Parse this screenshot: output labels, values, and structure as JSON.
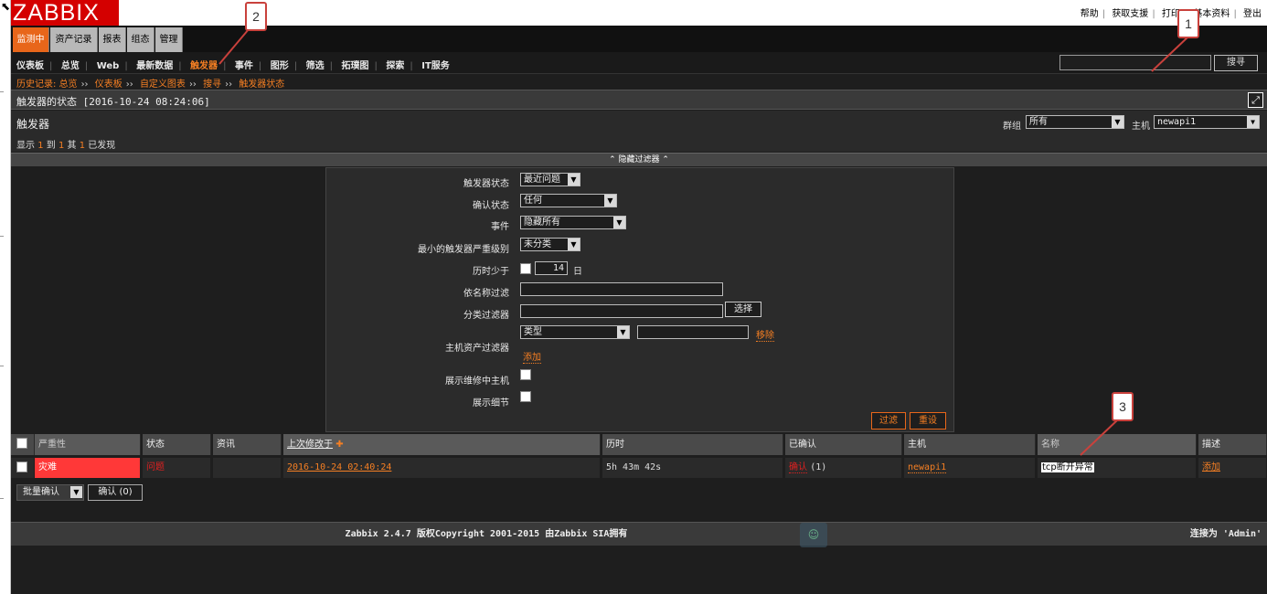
{
  "header": {
    "logo": "ZABBIX",
    "links": [
      "帮助",
      "获取支援",
      "打印",
      "基本资料",
      "登出"
    ]
  },
  "main_tabs": [
    {
      "label": "监测中",
      "active": true
    },
    {
      "label": "资产记录",
      "active": false
    },
    {
      "label": "报表",
      "active": false
    },
    {
      "label": "组态",
      "active": false
    },
    {
      "label": "管理",
      "active": false
    }
  ],
  "sub_tabs": [
    {
      "label": "仪表板",
      "active": false
    },
    {
      "label": "总览",
      "active": false
    },
    {
      "label": "Web",
      "active": false
    },
    {
      "label": "最新数据",
      "active": false
    },
    {
      "label": "触发器",
      "active": true
    },
    {
      "label": "事件",
      "active": false
    },
    {
      "label": "图形",
      "active": false
    },
    {
      "label": "筛选",
      "active": false
    },
    {
      "label": "拓璞图",
      "active": false
    },
    {
      "label": "探索",
      "active": false
    },
    {
      "label": "IT服务",
      "active": false
    }
  ],
  "search": {
    "value": "",
    "button": "搜寻"
  },
  "breadcrumb": {
    "label": "历史记录:",
    "items": [
      "总览",
      "仪表板",
      "自定义图表",
      "搜寻",
      "触发器状态"
    ]
  },
  "status_bar": {
    "title": "触发器的状态 [2016-10-24 08:24:06]"
  },
  "trigger_section": {
    "title": "触发器",
    "count_prefix": "显示",
    "count_from": "1",
    "count_to_label": "到",
    "count_to": "1",
    "count_of_label": "其",
    "count_total": "1",
    "count_suffix": "已发现",
    "group_label": "群组",
    "group_value": "所有",
    "host_label": "主机",
    "host_value": "newapi1"
  },
  "filter": {
    "toggle_label": "隐藏过滤器",
    "trigger_status_label": "触发器状态",
    "trigger_status_value": "最近问题",
    "ack_status_label": "确认状态",
    "ack_status_value": "任何",
    "events_label": "事件",
    "events_value": "隐藏所有",
    "min_severity_label": "最小的触发器严重级别",
    "min_severity_value": "未分类",
    "age_label": "历时少于",
    "age_value": "14",
    "age_unit": "日",
    "name_filter_label": "依名称过滤",
    "app_filter_label": "分类过滤器",
    "app_select_button": "选择",
    "inventory_filter_label": "主机资产过滤器",
    "inventory_type_value": "类型",
    "inventory_remove": "移除",
    "inventory_add": "添加",
    "maintenance_label": "展示维修中主机",
    "details_label": "展示细节",
    "filter_button": "过滤",
    "reset_button": "重设"
  },
  "table": {
    "headers": [
      "严重性",
      "状态",
      "资讯",
      "上次修改于",
      "历时",
      "已确认",
      "主机",
      "名称",
      "描述"
    ],
    "rows": [
      {
        "severity": "灾难",
        "status": "问题",
        "info": "",
        "last_change": "2016-10-24 02:40:24",
        "age": "5h 43m 42s",
        "ack": "确认",
        "ack_count": "(1)",
        "host": "newapi1",
        "name": "tcp断开异常",
        "description": "添加"
      }
    ]
  },
  "actions": {
    "bulk_select": "批量确认",
    "ack_button": "确认 (0)"
  },
  "footer": {
    "copyright": "Zabbix 2.4.7 版权Copyright 2001-2015 由Zabbix SIA拥有",
    "user": "连接为 'Admin'"
  },
  "callouts": [
    "1",
    "2",
    "3"
  ],
  "colors": {
    "accent": "#f57f23",
    "logo": "#d40000",
    "disaster": "#ff3838"
  }
}
